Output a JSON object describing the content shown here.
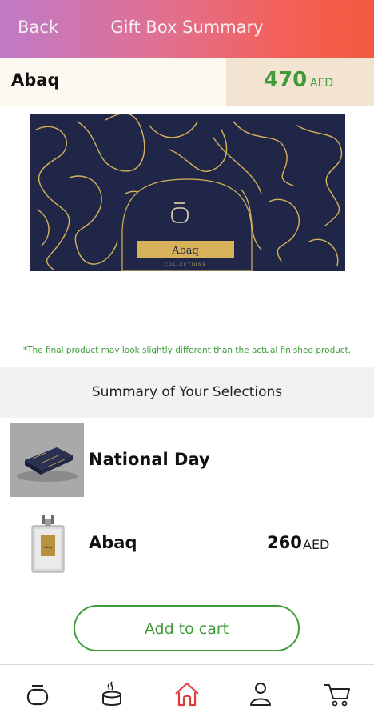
{
  "header": {
    "back_label": "Back",
    "title": "Gift Box Summary"
  },
  "product": {
    "name": "Abaq",
    "total": "470",
    "currency": "AED"
  },
  "box_image": {
    "label": "Abaq",
    "sublabel": "COLLECTIONS"
  },
  "disclaimer": "*The final product may look slightly different than the actual finished product.",
  "summary": {
    "title": "Summary of Your Selections",
    "items": [
      {
        "name": "National Day"
      },
      {
        "name": "Abaq",
        "price": "260",
        "currency": "AED",
        "bottle_label": "Abaq"
      }
    ]
  },
  "cart_button": "Add to cart",
  "tabs": [
    {
      "icon": "brand-logo-icon"
    },
    {
      "icon": "candle-icon"
    },
    {
      "icon": "home-icon",
      "active": true
    },
    {
      "icon": "user-icon"
    },
    {
      "icon": "cart-icon"
    }
  ],
  "colors": {
    "accent_green": "#3f9b3a",
    "active_tab": "#e03a3a",
    "box_navy": "#1f2648",
    "gold": "#d8b25a"
  }
}
